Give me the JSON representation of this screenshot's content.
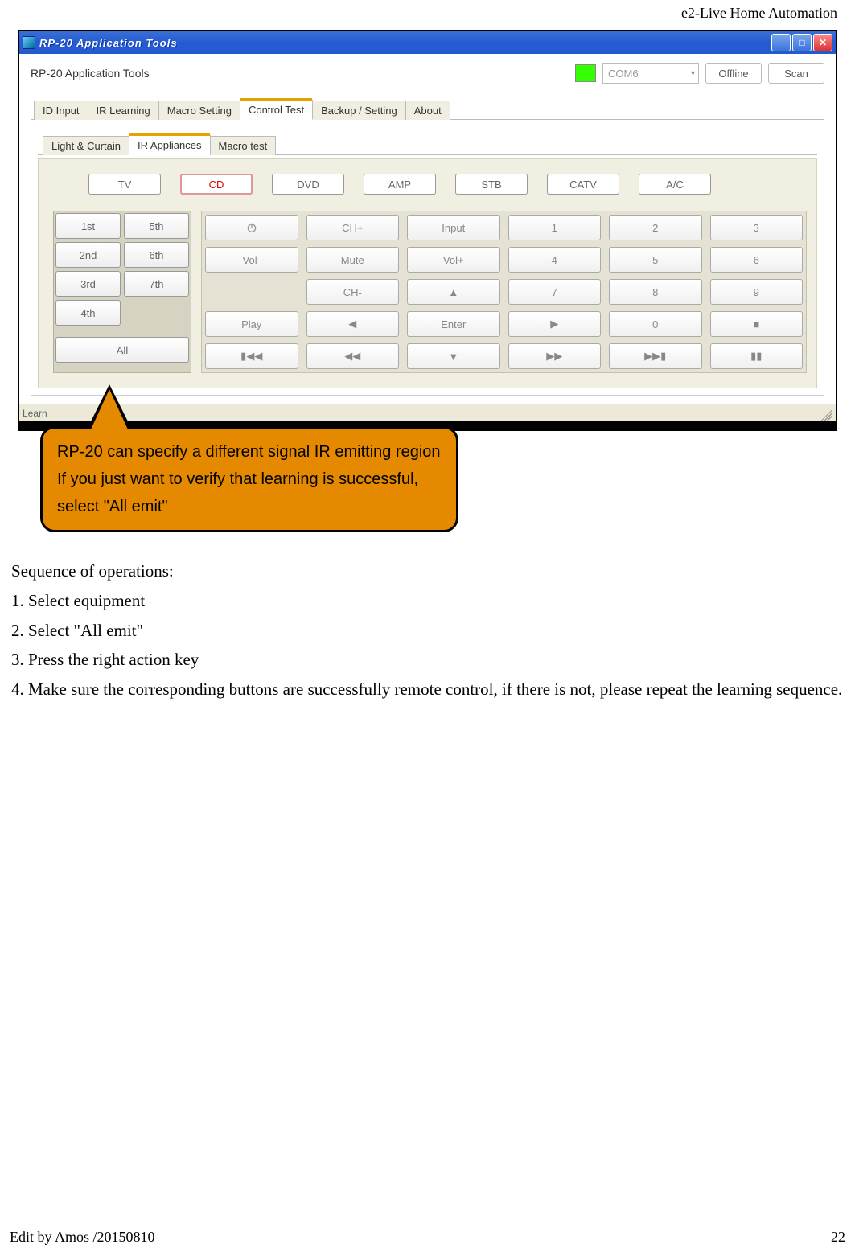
{
  "doc": {
    "header": "e2-Live Home Automation",
    "footer_left": "Edit by Amos /20150810",
    "footer_right": "22",
    "callout": "RP-20 can specify a different signal IR emitting region If you just want to verify that learning is successful, select \"All emit\"",
    "seq_title": "Sequence of operations:",
    "seq1": "1. Select equipment",
    "seq2": "2. Select \"All emit\"",
    "seq3": "3. Press the right action key",
    "seq4": "4. Make sure the corresponding buttons are successfully remote control, if there is not, please repeat the learning sequence."
  },
  "window": {
    "title": "RP-20 Application Tools",
    "toolbar_title": "RP-20 Application Tools",
    "com": "COM6",
    "offline": "Offline",
    "scan": "Scan",
    "status": "Learn"
  },
  "tabs": {
    "main": [
      "ID Input",
      "IR Learning",
      "Macro Setting",
      "Control Test",
      "Backup / Setting",
      "About"
    ],
    "sub": [
      "Light & Curtain",
      "IR Appliances",
      "Macro test"
    ]
  },
  "devices": [
    "TV",
    "CD",
    "DVD",
    "AMP",
    "STB",
    "CATV",
    "A/C"
  ],
  "emit": {
    "b1": "1st",
    "b2": "2nd",
    "b3": "3rd",
    "b4": "4th",
    "b5": "5th",
    "b6": "6th",
    "b7": "7th",
    "all": "All"
  },
  "cmd": {
    "power": "⏻",
    "chp": "CH+",
    "input": "Input",
    "n1": "1",
    "n2": "2",
    "n3": "3",
    "volm": "Vol-",
    "mute": "Mute",
    "volp": "Vol+",
    "n4": "4",
    "n5": "5",
    "n6": "6",
    "blank": "",
    "chm": "CH-",
    "up": "▲",
    "n7": "7",
    "n8": "8",
    "n9": "9",
    "play": "Play",
    "left": "◀",
    "enter": "Enter",
    "right": "▶",
    "n0": "0",
    "stop": "■",
    "skipb": "▮◀◀",
    "rew": "◀◀",
    "down": "▼",
    "ff": "▶▶",
    "skipf": "▶▶▮",
    "pause": "▮▮"
  }
}
